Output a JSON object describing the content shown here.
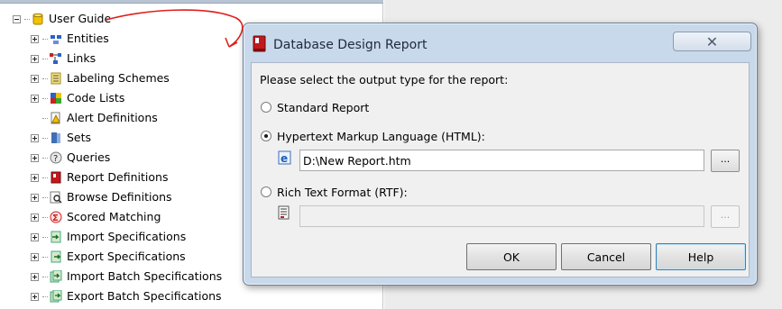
{
  "tree": {
    "root": {
      "label": "User Guide",
      "icon": "database-icon"
    },
    "items": [
      {
        "label": "Entities",
        "icon": "entities-icon",
        "expandable": true
      },
      {
        "label": "Links",
        "icon": "links-icon",
        "expandable": true
      },
      {
        "label": "Labeling Schemes",
        "icon": "labeling-schemes-icon",
        "expandable": true
      },
      {
        "label": "Code Lists",
        "icon": "code-lists-icon",
        "expandable": true
      },
      {
        "label": "Alert Definitions",
        "icon": "alert-definitions-icon",
        "expandable": false
      },
      {
        "label": "Sets",
        "icon": "sets-icon",
        "expandable": true
      },
      {
        "label": "Queries",
        "icon": "queries-icon",
        "expandable": true
      },
      {
        "label": "Report Definitions",
        "icon": "report-definitions-icon",
        "expandable": true
      },
      {
        "label": "Browse Definitions",
        "icon": "browse-definitions-icon",
        "expandable": true
      },
      {
        "label": "Scored Matching",
        "icon": "scored-matching-icon",
        "expandable": true
      },
      {
        "label": "Import Specifications",
        "icon": "import-specifications-icon",
        "expandable": true
      },
      {
        "label": "Export Specifications",
        "icon": "export-specifications-icon",
        "expandable": true
      },
      {
        "label": "Import Batch Specifications",
        "icon": "import-batch-specifications-icon",
        "expandable": true
      },
      {
        "label": "Export Batch Specifications",
        "icon": "export-batch-specifications-icon",
        "expandable": true
      }
    ]
  },
  "dialog": {
    "title": "Database Design Report",
    "close_label": "✕",
    "prompt": "Please select the output type for the report:",
    "options": {
      "standard": {
        "label": "Standard Report",
        "checked": false
      },
      "html": {
        "label": "Hypertext Markup Language (HTML):",
        "checked": true,
        "path": "D:\\New Report.htm"
      },
      "rtf": {
        "label": "Rich Text Format (RTF):",
        "checked": false,
        "path": ""
      }
    },
    "browse_label": "...",
    "buttons": {
      "ok": "OK",
      "cancel": "Cancel",
      "help": "Help"
    }
  },
  "colors": {
    "annotation_arrow": "#e0201c",
    "dialog_frame": "#c9d9ec"
  }
}
